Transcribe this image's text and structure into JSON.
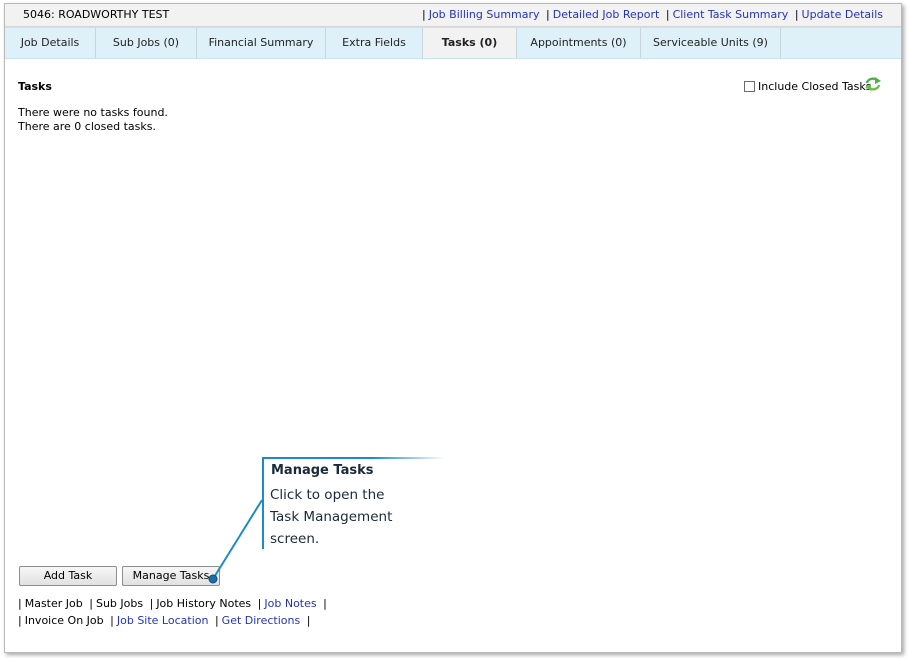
{
  "header": {
    "job_title": "5046: ROADWORTHY TEST",
    "links": [
      "Job Billing Summary",
      "Detailed Job Report",
      "Client Task Summary",
      "Update Details"
    ]
  },
  "tabs": [
    {
      "label": "Job Details"
    },
    {
      "label": "Sub Jobs (0)"
    },
    {
      "label": "Financial Summary"
    },
    {
      "label": "Extra Fields"
    },
    {
      "label": "Tasks (0)",
      "active": true
    },
    {
      "label": "Appointments (0)"
    },
    {
      "label": "Serviceable Units (9)"
    }
  ],
  "tasks": {
    "title": "Tasks",
    "no_tasks": "There were no tasks found.",
    "closed_count": "There are 0 closed tasks.",
    "include_closed_label": "Include Closed Tasks",
    "include_closed_checked": false,
    "refresh_icon": "refresh-icon"
  },
  "buttons": {
    "add_task": "Add Task",
    "manage_tasks": "Manage Tasks"
  },
  "footer": {
    "row1": [
      "Master Job",
      "Sub Jobs",
      "Job History Notes",
      "Job Notes"
    ],
    "row2": [
      "Invoice On Job",
      "Job Site Location",
      "Get Directions"
    ]
  },
  "callout": {
    "title": "Manage Tasks",
    "line1": "Click to open the",
    "line2": "Task Management",
    "line3": "screen."
  },
  "colors": {
    "link": "#2434b5",
    "tab_bar": "#dff1f8",
    "callout_accent": "#1b8cc7",
    "refresh_green": "#4caf50"
  }
}
